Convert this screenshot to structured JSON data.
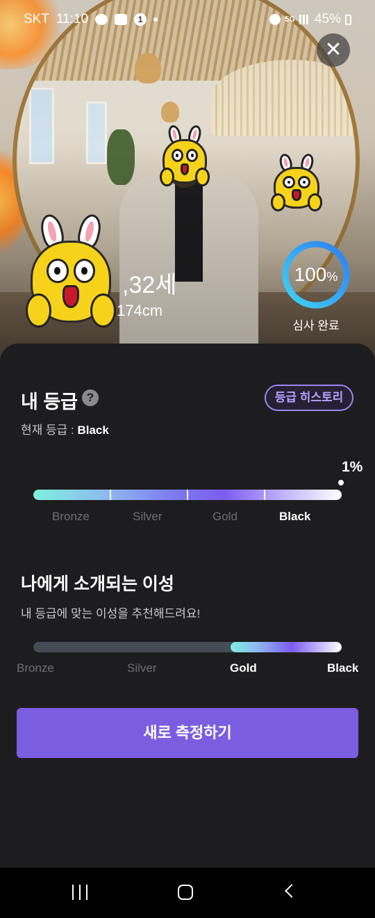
{
  "status_bar": {
    "carrier": "SKT",
    "time": "11:10",
    "network": "5G",
    "battery": "45%"
  },
  "profile": {
    "age": ",32세",
    "height": "174cm",
    "review_percent": "100",
    "review_percent_unit": "%",
    "review_progress": 1.0,
    "review_label": "심사 완료"
  },
  "grade": {
    "title": "내 등급",
    "help_icon": "question-circle-icon",
    "history_button": "등급 히스토리",
    "current_label": "현재 등급 : ",
    "current_value": "Black",
    "percentile": "1%",
    "tiers": [
      "Bronze",
      "Silver",
      "Gold",
      "Black"
    ],
    "active_tier": "Black"
  },
  "match": {
    "title": "나에게 소개되는 이성",
    "subtitle": "내 등급에 맞는 이성을 추천해드려요!",
    "tiers": [
      "Bronze",
      "Silver",
      "Gold",
      "Black"
    ],
    "active_tiers": [
      "Gold",
      "Black"
    ],
    "highlight_start_fraction": 0.64
  },
  "cta": {
    "label": "새로 측정하기"
  },
  "colors": {
    "background": "#1d1c1f",
    "accent": "#7b5de0",
    "ring": "#3aa0f5",
    "history_border": "#9b86f4"
  },
  "icons": {
    "close": "close-icon",
    "nav_recents": "recents-icon",
    "nav_home": "home-icon",
    "nav_back": "back-icon"
  }
}
